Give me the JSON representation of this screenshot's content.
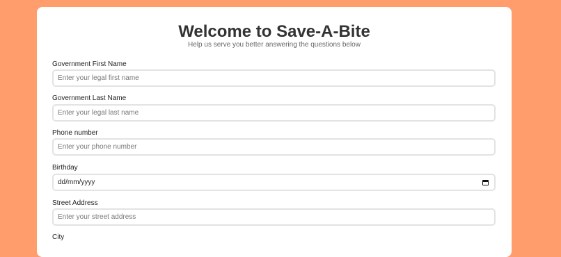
{
  "header": {
    "title": "Welcome to Save-A-Bite",
    "subtitle": "Help us serve you better answering the questions below"
  },
  "form": {
    "first_name": {
      "label": "Government First Name",
      "placeholder": "Enter your legal first name"
    },
    "last_name": {
      "label": "Government Last Name",
      "placeholder": "Enter your legal last name"
    },
    "phone": {
      "label": "Phone number",
      "placeholder": "Enter your phone number"
    },
    "birthday": {
      "label": "Birthday",
      "value": "dd/mm/yyyy",
      "icon": "calendar-icon"
    },
    "street": {
      "label": "Street Address",
      "placeholder": "Enter your street address"
    },
    "city": {
      "label": "City"
    }
  },
  "colors": {
    "background": "#ff9d6c",
    "card": "#ffffff",
    "title": "#333333"
  }
}
